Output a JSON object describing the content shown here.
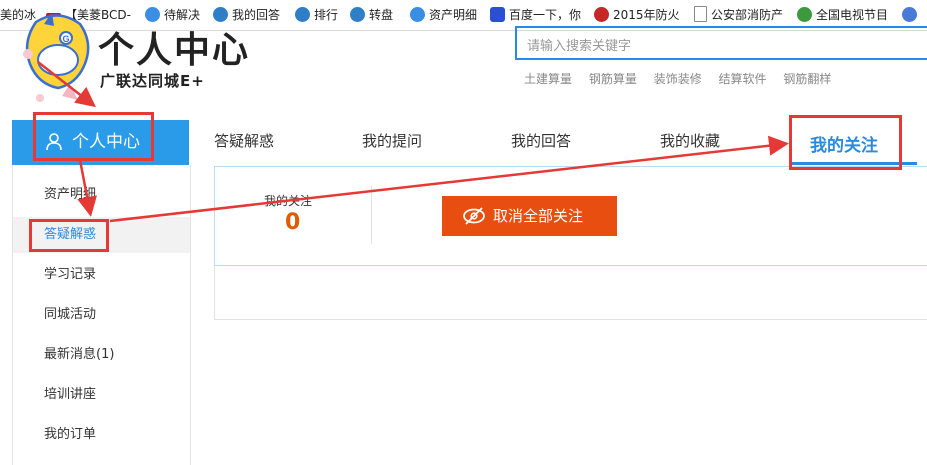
{
  "bookmarks": [
    {
      "label": "美的冰",
      "icon": "none"
    },
    {
      "label": "【美菱BCD-",
      "icon": "jd-icon"
    },
    {
      "label": "待解决",
      "icon": "question-icon"
    },
    {
      "label": "我的回答",
      "icon": "person-icon"
    },
    {
      "label": "排行",
      "icon": "person-icon"
    },
    {
      "label": "转盘",
      "icon": "person-icon"
    },
    {
      "label": "资产明细",
      "icon": "question-icon"
    },
    {
      "label": "百度一下，你",
      "icon": "baidu-paw-icon"
    },
    {
      "label": "2015年防火",
      "icon": "emblem-icon"
    },
    {
      "label": "公安部消防产",
      "icon": "page-icon"
    },
    {
      "label": "全国电视节目",
      "icon": "tv-icon"
    },
    {
      "label": "≫",
      "icon": "more-icon"
    }
  ],
  "header": {
    "title": "个人中心",
    "subtitle": "广联达同城E+",
    "search_placeholder": "请输入搜索关键字",
    "hot_keywords": [
      "土建算量",
      "钢筋算量",
      "装饰装修",
      "结算软件",
      "钢筋翻样"
    ]
  },
  "sidebar": {
    "heading": "个人中心",
    "items": [
      {
        "label": "资产明细",
        "active": false
      },
      {
        "label": "答疑解惑",
        "active": true
      },
      {
        "label": "学习记录",
        "active": false
      },
      {
        "label": "同城活动",
        "active": false
      },
      {
        "label": "最新消息(1)",
        "active": false
      },
      {
        "label": "培训讲座",
        "active": false
      },
      {
        "label": "我的订单",
        "active": false
      }
    ]
  },
  "tabs": [
    {
      "label": "答疑解惑",
      "active": false
    },
    {
      "label": "我的提问",
      "active": false
    },
    {
      "label": "我的回答",
      "active": false
    },
    {
      "label": "我的收藏",
      "active": false
    },
    {
      "label": "我的关注",
      "active": true
    }
  ],
  "follow_panel": {
    "stat_label": "我的关注",
    "stat_value": "0",
    "cancel_all_label": "取消全部关注"
  },
  "colors": {
    "accent": "#2a8ae0",
    "sidebar_header": "#2a9be8",
    "cancel_button": "#e84e0f",
    "count": "#e05a00",
    "annotation": "#e53935"
  }
}
